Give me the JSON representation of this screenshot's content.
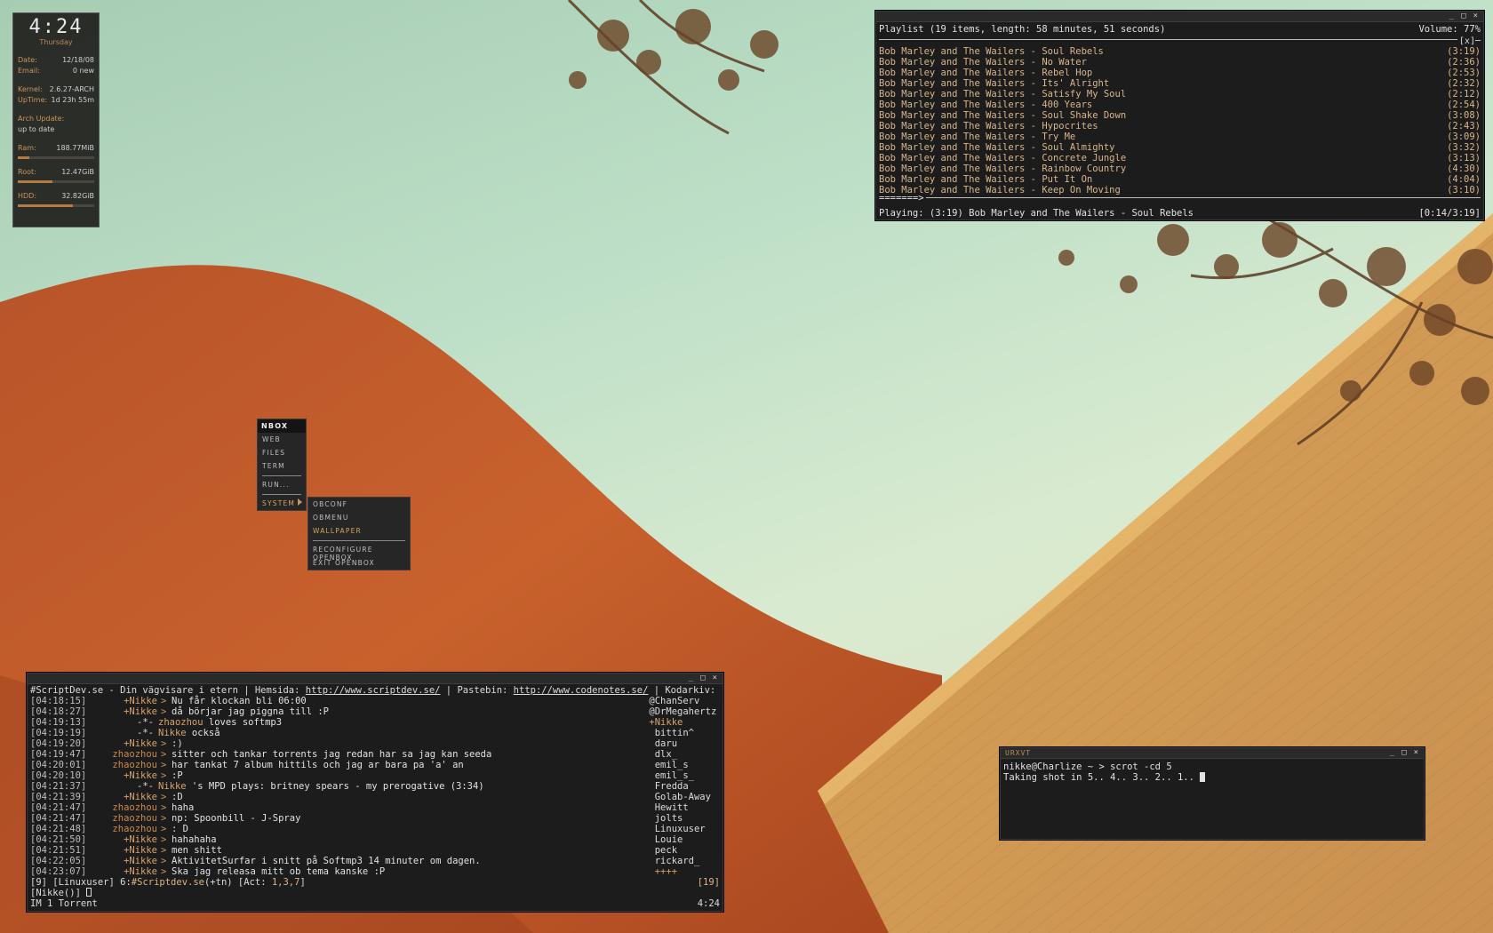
{
  "conky": {
    "clock": "4:24",
    "day": "Thursday",
    "date_label": "Date:",
    "date_value": "12/18/08",
    "email_label": "Email:",
    "email_value": "0 new",
    "kernel_label": "Kernel:",
    "kernel_value": "2.6.27-ARCH",
    "uptime_label": "UpTime:",
    "uptime_value": "1d 23h 55m",
    "arch_label": "Arch Update:",
    "arch_value": "up to date",
    "ram_label": "Ram:",
    "ram_value": "188.77MiB",
    "ram_fill": 0.15,
    "root_label": "Root:",
    "root_value": "12.47GiB",
    "root_fill": 0.45,
    "hdd_label": "HDD:",
    "hdd_value": "32.82GiB",
    "hdd_fill": 0.72
  },
  "playlist": {
    "header": "Playlist (19 items, length: 58 minutes, 51 seconds)",
    "volume": "Volume: 77%",
    "close_mark": "[x]─",
    "tracks": [
      {
        "title": "Bob Marley and The Wailers - Soul Rebels",
        "dur": "(3:19)"
      },
      {
        "title": "Bob Marley and The Wailers - No Water",
        "dur": "(2:36)"
      },
      {
        "title": "Bob Marley and The Wailers - Rebel Hop",
        "dur": "(2:53)"
      },
      {
        "title": "Bob Marley and The Wailers - Its' Alright",
        "dur": "(2:32)"
      },
      {
        "title": "Bob Marley and The Wailers - Satisfy My Soul",
        "dur": "(2:12)"
      },
      {
        "title": "Bob Marley and The Wailers - 400 Years",
        "dur": "(2:54)"
      },
      {
        "title": "Bob Marley and The Wailers - Soul Shake Down",
        "dur": "(3:08)"
      },
      {
        "title": "Bob Marley and The Wailers - Hypocrites",
        "dur": "(2:43)"
      },
      {
        "title": "Bob Marley and The Wailers - Try Me",
        "dur": "(3:09)"
      },
      {
        "title": "Bob Marley and The Wailers - Soul Almighty",
        "dur": "(3:32)"
      },
      {
        "title": "Bob Marley and The Wailers - Concrete Jungle",
        "dur": "(3:13)"
      },
      {
        "title": "Bob Marley and The Wailers - Rainbow Country",
        "dur": "(4:30)"
      },
      {
        "title": "Bob Marley and The Wailers - Put It On",
        "dur": "(4:04)"
      },
      {
        "title": "Bob Marley and The Wailers - Keep On Moving",
        "dur": "(3:10)"
      }
    ],
    "progress_arrow": "=======>",
    "now_playing": "Playing: (3:19) Bob Marley and The Wailers - Soul Rebels",
    "position": "[0:14/3:19]"
  },
  "menu": {
    "title": "NBOX",
    "items": [
      "WEB",
      "FILES",
      "TERM"
    ],
    "run": "RUN...",
    "system": "SYSTEM",
    "sub": {
      "obconf": "OBCONF",
      "obmenu": "OBMENU",
      "wallpaper": "WALLPAPER",
      "reconfigure": "RECONFIGURE OPENBOX",
      "exit": "EXIT OPENBOX"
    }
  },
  "irc": {
    "topic_prefix": "#ScriptDev.se - Din vägvisare i etern | Hemsida: ",
    "topic_link1": "http://www.scriptdev.se/",
    "topic_mid": " | Pastebin: ",
    "topic_link2": "http://www.codenotes.se/",
    "topic_suffix": " | Kodarkiv: http:++",
    "messages": [
      {
        "ts": "[04:18:15]",
        "nick": "+Nikke",
        "sep": ">",
        "text": "Nu får klockan bli 06:00",
        "kind": "self"
      },
      {
        "ts": "[04:18:27]",
        "nick": "+Nikke",
        "sep": ">",
        "text": "då börjar jag piggna till :P",
        "kind": "self"
      },
      {
        "ts": "[04:19:13]",
        "nick": "",
        "sep": "-*-",
        "hl": "zhaozhou",
        "text": " loves softmp3",
        "kind": "action"
      },
      {
        "ts": "[04:19:19]",
        "nick": "",
        "sep": "-*-",
        "hl": "Nikke",
        "text": " också",
        "kind": "action"
      },
      {
        "ts": "[04:19:20]",
        "nick": "+Nikke",
        "sep": ">",
        "text": ":)",
        "kind": "self"
      },
      {
        "ts": "[04:19:47]",
        "nick": "zhaozhou",
        "sep": ">",
        "text": "sitter och tankar torrents jag redan har sa jag kan seeda",
        "kind": "other"
      },
      {
        "ts": "[04:20:01]",
        "nick": "zhaozhou",
        "sep": ">",
        "text": "har tankat 7 album hittils och jag ar bara pa 'a' an",
        "kind": "other"
      },
      {
        "ts": "[04:20:10]",
        "nick": "+Nikke",
        "sep": ">",
        "text": ":P",
        "kind": "self"
      },
      {
        "ts": "[04:21:37]",
        "nick": "",
        "sep": "-*-",
        "hl": "Nikke",
        "text": " 's MPD plays: britney spears - my prerogative (3:34)",
        "kind": "action"
      },
      {
        "ts": "[04:21:39]",
        "nick": "+Nikke",
        "sep": ">",
        "text": ":D",
        "kind": "self"
      },
      {
        "ts": "[04:21:47]",
        "nick": "zhaozhou",
        "sep": ">",
        "text": "haha",
        "kind": "other"
      },
      {
        "ts": "[04:21:47]",
        "nick": "zhaozhou",
        "sep": ">",
        "text": "np: Spoonbill - J-Spray",
        "kind": "other"
      },
      {
        "ts": "[04:21:48]",
        "nick": "zhaozhou",
        "sep": ">",
        "text": ": D",
        "kind": "other"
      },
      {
        "ts": "[04:21:50]",
        "nick": "+Nikke",
        "sep": ">",
        "text": "hahahaha",
        "kind": "self"
      },
      {
        "ts": "[04:21:51]",
        "nick": "+Nikke",
        "sep": ">",
        "text": "men shitt",
        "kind": "self"
      },
      {
        "ts": "[04:22:05]",
        "nick": "+Nikke",
        "sep": ">",
        "text": "AktivitetSurfar i snitt på Softmp3 14 minuter om dagen.",
        "kind": "self"
      },
      {
        "ts": "[04:23:07]",
        "nick": "+Nikke",
        "sep": ">",
        "text": "Ska jag releasa mitt ob tema kanske :P",
        "kind": "self"
      }
    ],
    "users": [
      {
        "name": "@ChanServ",
        "kind": "op"
      },
      {
        "name": "@DrMegahertz",
        "kind": "op"
      },
      {
        "name": "+Nikke",
        "kind": "voice"
      },
      {
        "name": " bittin^",
        "kind": "normal"
      },
      {
        "name": " daru",
        "kind": "normal"
      },
      {
        "name": " dlx_",
        "kind": "normal"
      },
      {
        "name": " emil_s",
        "kind": "normal"
      },
      {
        "name": " emil_s_",
        "kind": "normal"
      },
      {
        "name": " Fredda",
        "kind": "normal"
      },
      {
        "name": " Golab-Away",
        "kind": "normal"
      },
      {
        "name": " Hewitt",
        "kind": "normal"
      },
      {
        "name": " jolts",
        "kind": "normal"
      },
      {
        "name": " Linuxuser",
        "kind": "normal"
      },
      {
        "name": " Louie",
        "kind": "normal"
      },
      {
        "name": " peck",
        "kind": "normal"
      },
      {
        "name": " rickard_",
        "kind": "normal"
      },
      {
        "name": " ++++",
        "kind": "voice"
      }
    ],
    "status_left": "[9] [Linuxuser] 6:",
    "status_chan": "#Scriptdev.se",
    "status_mode": "(+tn) [Act: ",
    "status_act": "1,3,7",
    "status_close": "]",
    "status_right": "[19]",
    "input_prompt": "[Nikke()] ",
    "bottom_left": "IM  1 Torrent",
    "bottom_right": "4:24"
  },
  "urxvt": {
    "title": "URXVT",
    "line1": "nikke@Charlize ~ > scrot -cd 5",
    "line2": "Taking shot in 5.. 4.. 3.. 2.. 1.. "
  },
  "window_buttons": {
    "min": "_",
    "max": "□",
    "close": "×"
  }
}
